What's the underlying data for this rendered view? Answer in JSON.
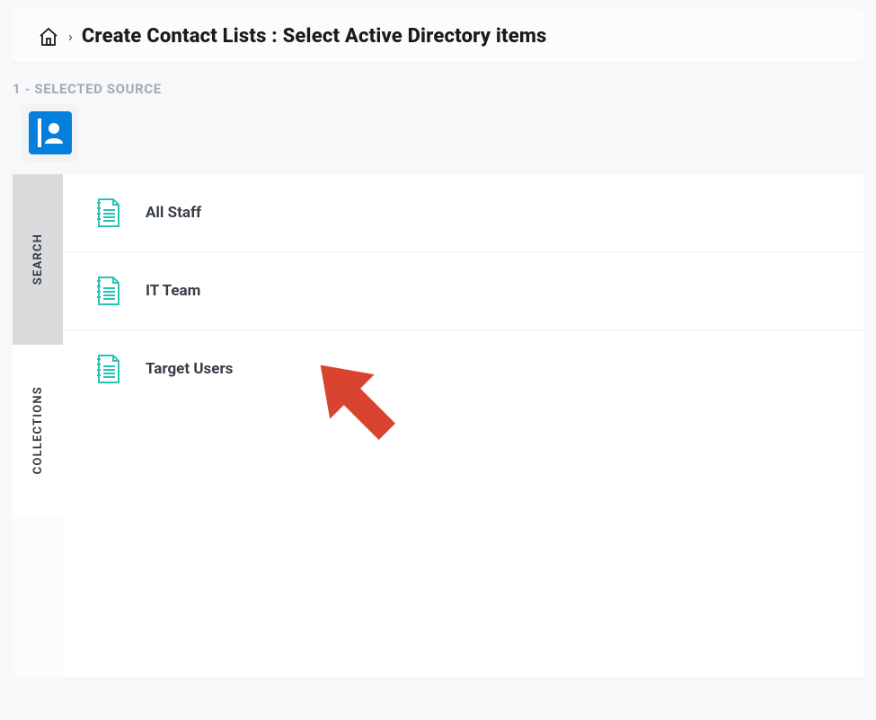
{
  "breadcrumb": {
    "title": "Create Contact Lists  :   Select Active Directory items"
  },
  "step_label": "1 - SELECTED SOURCE",
  "tabs": {
    "search": "SEARCH",
    "collections": "COLLECTIONS"
  },
  "items": [
    {
      "label": "All Staff"
    },
    {
      "label": "IT Team"
    },
    {
      "label": "Target Users"
    }
  ],
  "colors": {
    "accent_blue": "#067fdc",
    "doc_teal": "#29c3b6",
    "arrow_red": "#d94431"
  }
}
